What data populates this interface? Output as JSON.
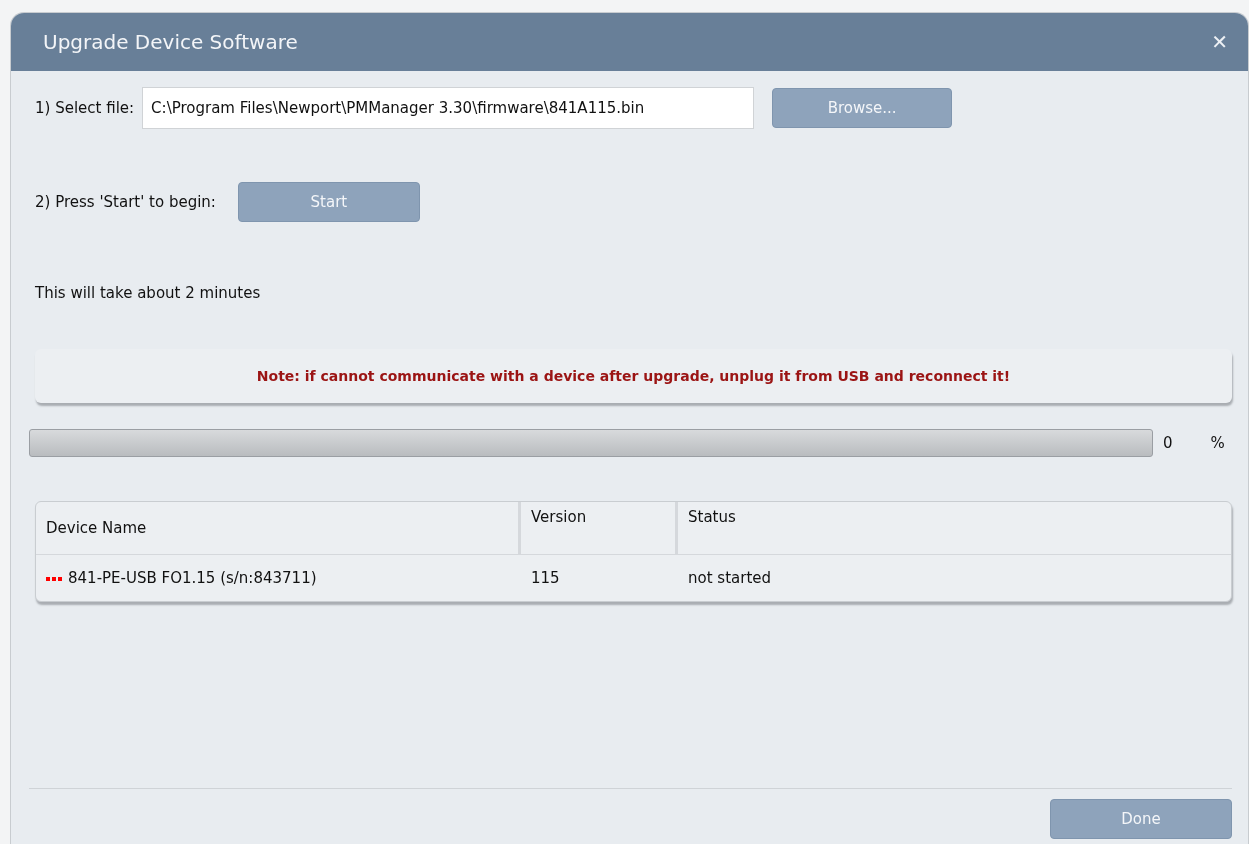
{
  "window": {
    "title": "Upgrade Device Software",
    "close": "✕"
  },
  "step1": {
    "label": "1) Select file:",
    "value": "C:\\Program Files\\Newport\\PMManager 3.30\\firmware\\841A115.bin",
    "button": "Browse..."
  },
  "step2": {
    "label": "2) Press 'Start' to begin:",
    "button": "Start"
  },
  "duration_note": "This will take about 2 minutes",
  "warning": "Note: if cannot communicate with a device after upgrade, unplug it from USB and reconnect it!",
  "progress": {
    "level": 0,
    "reading": "0",
    "unit": "%"
  },
  "table": {
    "columns": [
      "Device Name",
      "Version",
      "Status"
    ],
    "rows": [
      {
        "cells": [
          "841-PE-USB FO1.15 (s/n:843711)",
          "115",
          "not started"
        ],
        "color": "#ff0000"
      }
    ]
  },
  "buttons": [
    "Done"
  ]
}
